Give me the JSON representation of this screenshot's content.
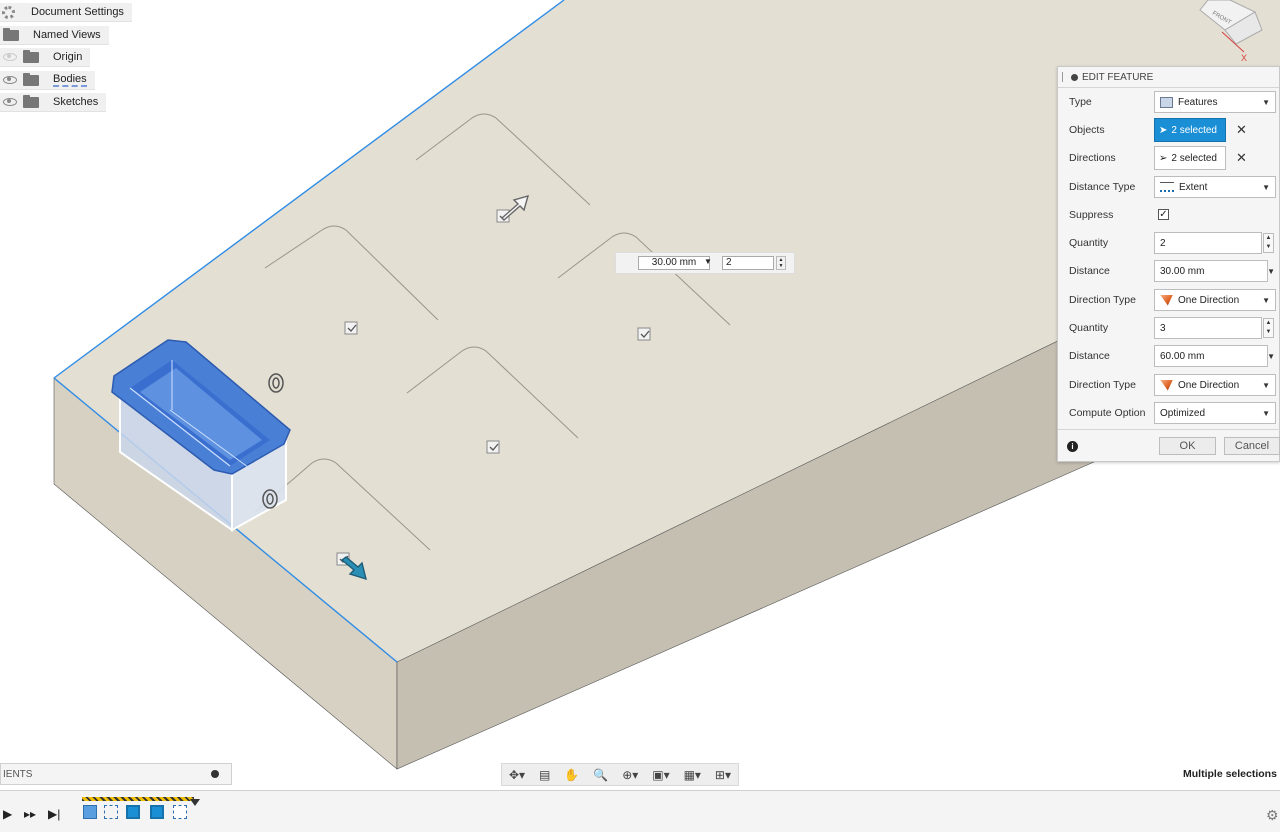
{
  "browser": {
    "items": [
      {
        "label": "Document Settings",
        "icon": "gear-icon"
      },
      {
        "label": "Named Views",
        "icon": "folder-icon"
      },
      {
        "label": "Origin",
        "icon": "folder-icon",
        "visible": false
      },
      {
        "label": "Bodies",
        "icon": "folder-icon",
        "visible": true
      },
      {
        "label": "Sketches",
        "icon": "folder-icon",
        "visible": true
      }
    ]
  },
  "edit_feature": {
    "title": "EDIT FEATURE",
    "rows": {
      "type": {
        "label": "Type",
        "value": "Features"
      },
      "objects": {
        "label": "Objects",
        "value": "2 selected"
      },
      "directions": {
        "label": "Directions",
        "value": "2 selected"
      },
      "distance_type": {
        "label": "Distance Type",
        "value": "Extent"
      },
      "suppress": {
        "label": "Suppress",
        "checked": true
      },
      "quantity1": {
        "label": "Quantity",
        "value": "2"
      },
      "distance1": {
        "label": "Distance",
        "value": "30.00 mm"
      },
      "direction_type1": {
        "label": "Direction Type",
        "value": "One Direction"
      },
      "quantity2": {
        "label": "Quantity",
        "value": "3"
      },
      "distance2": {
        "label": "Distance",
        "value": "60.00 mm"
      },
      "direction_type2": {
        "label": "Direction Type",
        "value": "One Direction"
      },
      "compute_option": {
        "label": "Compute Option",
        "value": "Optimized"
      }
    },
    "ok_label": "OK",
    "cancel_label": "Cancel",
    "accent": "#1a8fd6"
  },
  "viewport": {
    "distance_value": "30.00 mm",
    "quantity_value": "2",
    "viewcube_label": "FRONT"
  },
  "comments": {
    "label": "IENTS"
  },
  "status": {
    "text": "Multiple selections"
  }
}
